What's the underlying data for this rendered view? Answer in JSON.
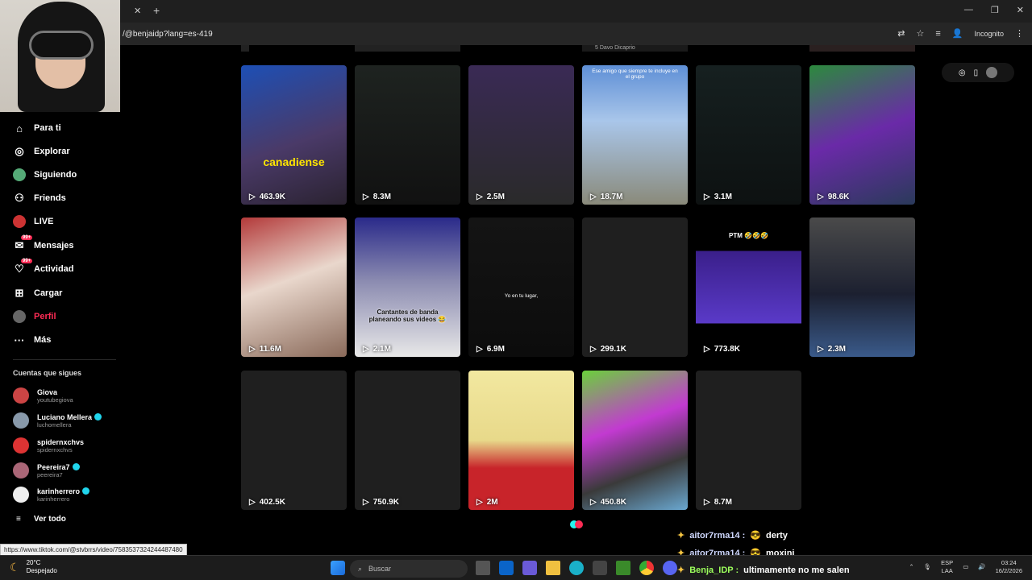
{
  "browser": {
    "url": "/@benjaidp?lang=es-419",
    "incognito_label": "Incognito"
  },
  "sidebar": {
    "nav": [
      {
        "label": "Para ti",
        "icon": "home-icon"
      },
      {
        "label": "Explorar",
        "icon": "compass-icon"
      },
      {
        "label": "Siguiendo",
        "icon": "avatar-icon"
      },
      {
        "label": "Friends",
        "icon": "friends-icon"
      },
      {
        "label": "LIVE",
        "icon": "live-icon"
      },
      {
        "label": "Mensajes",
        "icon": "messages-icon",
        "badge": "99+"
      },
      {
        "label": "Actividad",
        "icon": "activity-icon",
        "badge": "99+"
      },
      {
        "label": "Cargar",
        "icon": "upload-icon"
      },
      {
        "label": "Perfil",
        "icon": "profile-icon"
      },
      {
        "label": "Más",
        "icon": "more-icon"
      }
    ],
    "following_title": "Cuentas que sigues",
    "following": [
      {
        "name": "Giova",
        "handle": "youtubegiova",
        "verified": false
      },
      {
        "name": "Luciano Mellera",
        "handle": "luchomellera",
        "verified": true
      },
      {
        "name": "spidernxchvs",
        "handle": "spidernxchvs",
        "verified": false
      },
      {
        "name": "Peereira7",
        "handle": "peereira7",
        "verified": true
      },
      {
        "name": "karinherrero",
        "handle": "karinherrero",
        "verified": true
      }
    ],
    "see_all": "Ver todo"
  },
  "top_strip_text": "5 Davo Dicaprio",
  "videos": [
    {
      "views": "463.9K",
      "caption": "canadiense"
    },
    {
      "views": "8.3M",
      "caption": ""
    },
    {
      "views": "2.5M",
      "caption": ""
    },
    {
      "views": "18.7M",
      "caption": "Ese amigo que siempre te incluye en el grupo"
    },
    {
      "views": "3.1M",
      "caption": ""
    },
    {
      "views": "98.6K",
      "caption": ""
    },
    {
      "views": "11.6M",
      "caption": ""
    },
    {
      "views": "2.1M",
      "caption": "Cantantes de banda planeando sus videos 😂"
    },
    {
      "views": "6.9M",
      "caption": "Yo en tu lugar,"
    },
    {
      "views": "299.1K",
      "caption": ""
    },
    {
      "views": "773.8K",
      "caption": "PTM 🤣🤣🤣"
    },
    {
      "views": "2.3M",
      "caption": ""
    },
    {
      "views": "402.5K",
      "caption": ""
    },
    {
      "views": "750.9K",
      "caption": ""
    },
    {
      "views": "2M",
      "caption": ""
    },
    {
      "views": "450.8K",
      "caption": ""
    },
    {
      "views": "8.7M",
      "caption": ""
    }
  ],
  "status_url": "https://www.tiktok.com/@stvbrrs/video/7583537324244487480",
  "chat": [
    {
      "user": "aitor7rma14 :",
      "msg": "derty"
    },
    {
      "user": "aitor7rma14 :",
      "msg": "moxini"
    },
    {
      "user": "Benja_IDP :",
      "msg": "ultimamente no me salen"
    }
  ],
  "taskbar": {
    "temp": "20°C",
    "weather": "Despejado",
    "search_placeholder": "Buscar",
    "lang": "ESP",
    "lang2": "LAA",
    "time": "03:24",
    "date": "16/2/2026"
  }
}
